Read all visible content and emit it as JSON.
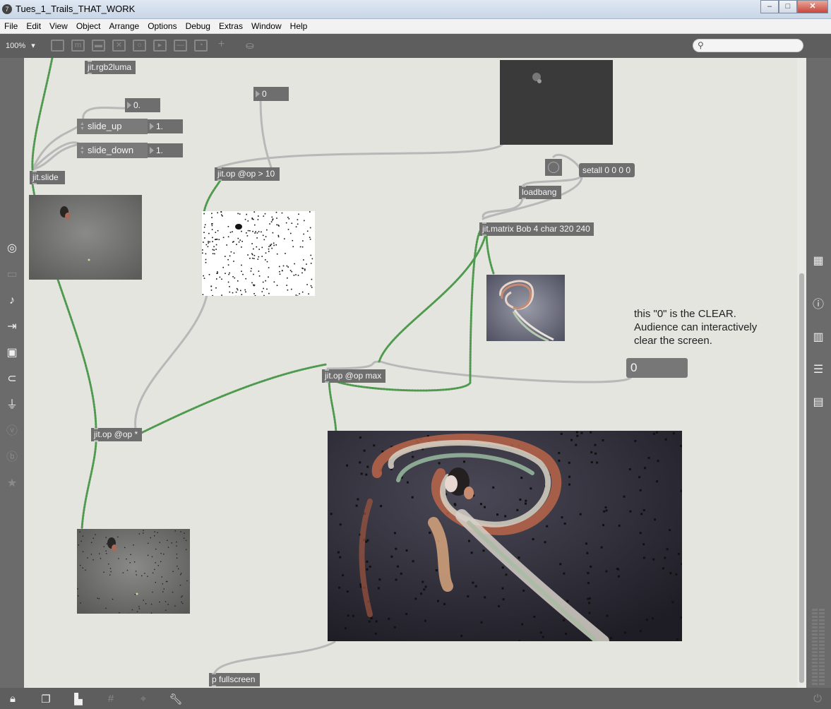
{
  "window": {
    "title": "Tues_1_Trails_THAT_WORK",
    "app_icon": "7"
  },
  "menubar": {
    "items": [
      "File",
      "Edit",
      "View",
      "Object",
      "Arrange",
      "Options",
      "Debug",
      "Extras",
      "Window",
      "Help"
    ]
  },
  "toolbar": {
    "zoom": "100%",
    "zoom_arrow": "▾"
  },
  "objects": {
    "rgb2luma": "jit.rgb2luma",
    "slide": "jit.slide",
    "op_gt": "jit.op @op > 10",
    "loadbang": "loadbang",
    "matrix": "jit.matrix Bob 4 char 320 240",
    "op_max": "jit.op @op max",
    "op_mul": "jit.op @op *",
    "fullscreen": "p fullscreen"
  },
  "number_boxes": {
    "slide_param": "0.",
    "slide_up_val": "1.",
    "slide_down_val": "1.",
    "threshold": "0"
  },
  "attrui": {
    "slide_up": "slide_up",
    "slide_down": "slide_down"
  },
  "message": {
    "setall": "setall 0 0 0 0"
  },
  "comment": {
    "line1": "this \"0\" is the CLEAR.",
    "line2": "Audience can interactively",
    "line3": "clear the screen."
  },
  "clear_number": "0",
  "colors": {
    "object_bg": "#6e6e6e",
    "canvas_bg": "#e5e5e0",
    "patch_cord": "#b4b4b4",
    "matrix_cord": "#5ba35b"
  }
}
